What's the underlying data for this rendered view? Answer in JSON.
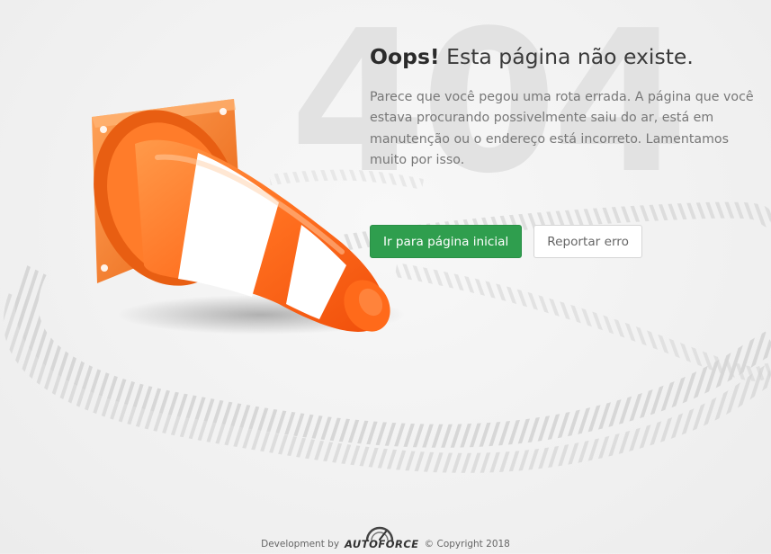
{
  "background_number": "404",
  "heading": {
    "emphasis": "Oops!",
    "text": " Esta página não existe."
  },
  "description": "Parece que você pegou uma rota errada. A página que você estava procurando possivelmente saiu do ar, está em manutenção ou o endereço está incorreto. Lamentamos muito por isso.",
  "actions": {
    "home_label": "Ir para página inicial",
    "report_label": "Reportar erro"
  },
  "footer": {
    "development_by": "Development by",
    "brand": "AUTOFORCE",
    "copyright": "© Copyright 2018"
  },
  "colors": {
    "primary_button": "#2f9e4e",
    "cone_orange": "#ff6a1a",
    "cone_stripe": "#ffffff"
  },
  "icons": {
    "illustration": "traffic-cone",
    "logo_mark": "speedometer-arc"
  }
}
